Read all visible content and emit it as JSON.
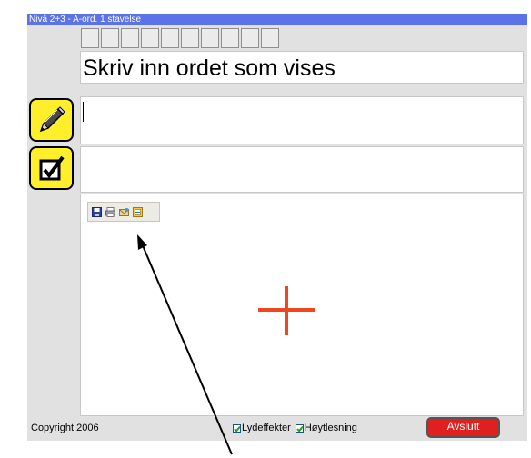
{
  "window": {
    "title": "Nivå 2+3 - A-ord. 1 stavelse"
  },
  "letter_boxes_count": 10,
  "instruction": {
    "text": "Skriv inn ordet som vises"
  },
  "side_buttons": {
    "pencil_icon": "pencil-icon",
    "check_icon": "checkbox-check-icon"
  },
  "answer_input": {
    "value": ""
  },
  "answer_check": {
    "value": ""
  },
  "mini_toolbar": {
    "icons": [
      "save-icon",
      "print-icon",
      "email-icon",
      "export-icon"
    ]
  },
  "crosshair": {
    "color": "#f0461e"
  },
  "footer": {
    "copyright": "Copyright 2006",
    "option_sound": "Lydeffekter",
    "option_readaloud": "Høytlesning",
    "exit_label": "Avslutt"
  },
  "colors": {
    "titlebar": "#5b73e6",
    "button_yellow": "#ffef2a",
    "exit_red": "#e02020"
  }
}
